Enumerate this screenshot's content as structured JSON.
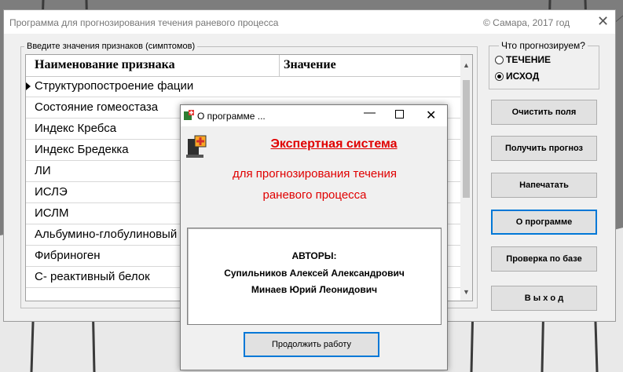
{
  "main_window": {
    "title": "Программа для прогнозирования течения раневого процесса",
    "copyright": "© Самара, 2017 год",
    "close_glyph": "✕"
  },
  "input_group": {
    "legend": "Введите значения признаков  (симптомов)",
    "columns": [
      "Наименование признака",
      "Значение"
    ],
    "rows": [
      "Структуропостроение фации",
      "Состояние гомеостаза",
      "Индекс Кребса",
      "Индекс Бредекка",
      "ЛИ",
      "ИСЛЭ",
      "ИСЛМ",
      "Альбумино-глобулиновый",
      "Фибриноген",
      "С- реактивный белок"
    ],
    "scroll_up": "▲",
    "scroll_down": "▼"
  },
  "predict_group": {
    "legend": "Что прогнозируем?",
    "options": [
      "ТЕЧЕНИЕ",
      "ИСХОД"
    ],
    "selected": "ИСХОД"
  },
  "buttons": {
    "clear": "Очистить поля",
    "predict": "Получить прогноз",
    "print": "Напечатать",
    "about": "О программе",
    "check_base": "Проверка по базе",
    "exit": "В ы х о д"
  },
  "about_dialog": {
    "title": "О программе ...",
    "minimize_glyph": "—",
    "close_glyph": "✕",
    "heading": "Экспертная система",
    "line1": "для прогнозирования течения",
    "line2": "раневого процесса",
    "authors_label": "АВТОРЫ:",
    "author1": "Супильников Алексей Александрович",
    "author2": "Минаев Юрий Леонидович",
    "continue_button": "Продолжить работу"
  },
  "colors": {
    "accent": "#0078d7",
    "heading_red": "#e00000"
  }
}
